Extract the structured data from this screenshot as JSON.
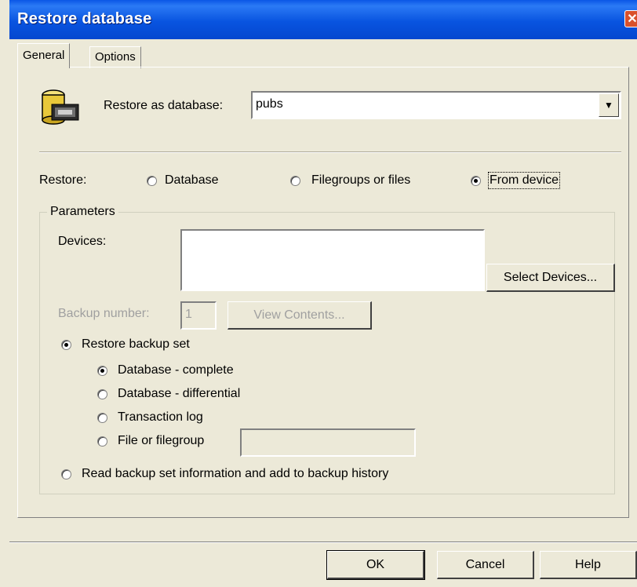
{
  "window": {
    "title": "Restore database",
    "close_icon": "close-icon"
  },
  "tabs": [
    {
      "label": "General",
      "active": true
    },
    {
      "label": "Options",
      "active": false
    }
  ],
  "restore_as": {
    "label": "Restore as database:",
    "value": "pubs"
  },
  "restore_type": {
    "label": "Restore:",
    "options": [
      "Database",
      "Filegroups or files",
      "From device"
    ],
    "selected": "From device"
  },
  "parameters": {
    "group_label": "Parameters",
    "devices_label": "Devices:",
    "select_devices_button": "Select Devices...",
    "backup_number_label": "Backup number:",
    "backup_number_value": "1",
    "view_contents_button": "View Contents...",
    "restore_backup_set_label": "Restore backup set",
    "backup_set_options": [
      "Database - complete",
      "Database - differential",
      "Transaction log",
      "File or filegroup"
    ],
    "selected_backup_set": "Database - complete",
    "read_info_label": "Read backup set information and add to backup history"
  },
  "footer": {
    "ok": "OK",
    "cancel": "Cancel",
    "help": "Help"
  },
  "colors": {
    "title_bar": "#0a56e6",
    "dialog_bg": "#ece9d8",
    "close_button": "#d9512c"
  }
}
